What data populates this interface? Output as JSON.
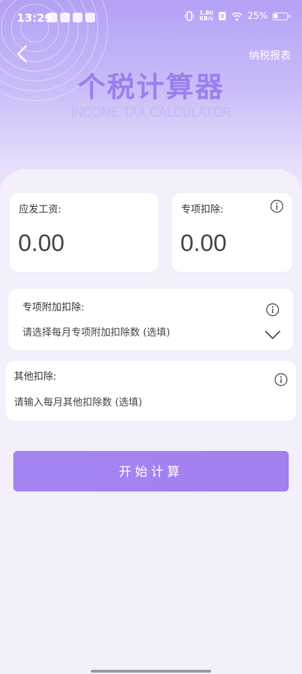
{
  "status_bar": {
    "time": "13:29",
    "net_speed_value": "1.80",
    "net_speed_unit": "KB/s",
    "battery": "25%"
  },
  "header": {
    "back_icon": "chevron-left-icon",
    "report_link": "纳税报表",
    "title": "个税计算器",
    "subtitle": "INCOME TAX CALCULATOR"
  },
  "salary_card": {
    "label": "应发工资:",
    "value": "0.00"
  },
  "special_deduction_card": {
    "label": "专项扣除:",
    "value": "0.00",
    "icon": "info-icon"
  },
  "additional_deduction_card": {
    "label": "专项附加扣除:",
    "placeholder": "请选择每月专项附加扣除数 (选填)",
    "icon": "info-icon",
    "dropdown_icon": "chevron-down-icon"
  },
  "other_deduction_card": {
    "label": "其他扣除:",
    "placeholder": "请输入每月其他扣除数 (选填)",
    "icon": "info-icon"
  },
  "calculate_button": {
    "label": "开始计算"
  },
  "colors": {
    "accent": "#a484f2",
    "title": "#9a80ee",
    "background": "#f3f0fc"
  }
}
